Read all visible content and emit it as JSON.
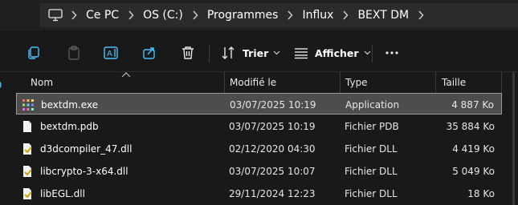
{
  "breadcrumb": {
    "items": [
      {
        "label": "Ce PC"
      },
      {
        "label": "OS (C:)"
      },
      {
        "label": "Programmes"
      },
      {
        "label": "Influx"
      },
      {
        "label": "BEXT DM"
      }
    ]
  },
  "toolbar": {
    "sort_label": "Trier",
    "view_label": "Afficher"
  },
  "columns": {
    "name": "Nom",
    "modified": "Modifié le",
    "type": "Type",
    "size": "Taille"
  },
  "files": [
    {
      "name": "bextdm.exe",
      "modified": "03/07/2025 10:19",
      "type": "Application",
      "size": "4 887 Ko",
      "icon": "exe-icon",
      "selected": true
    },
    {
      "name": "bextdm.pdb",
      "modified": "03/07/2025 10:19",
      "type": "Fichier PDB",
      "size": "35 884 Ko",
      "icon": "file-icon",
      "selected": false
    },
    {
      "name": "d3dcompiler_47.dll",
      "modified": "02/12/2020 04:30",
      "type": "Fichier DLL",
      "size": "4 419 Ko",
      "icon": "dll-icon",
      "selected": false
    },
    {
      "name": "libcrypto-3-x64.dll",
      "modified": "03/07/2025 10:07",
      "type": "Fichier DLL",
      "size": "5 049 Ko",
      "icon": "dll-icon",
      "selected": false
    },
    {
      "name": "libEGL.dll",
      "modified": "29/11/2024 12:23",
      "type": "Fichier DLL",
      "size": "18 Ko",
      "icon": "dll-icon",
      "selected": false
    }
  ],
  "colors": {
    "accent": "#4cc2ff",
    "selection_bg": "#4d4d4d",
    "selection_border": "#9a9a9a"
  }
}
